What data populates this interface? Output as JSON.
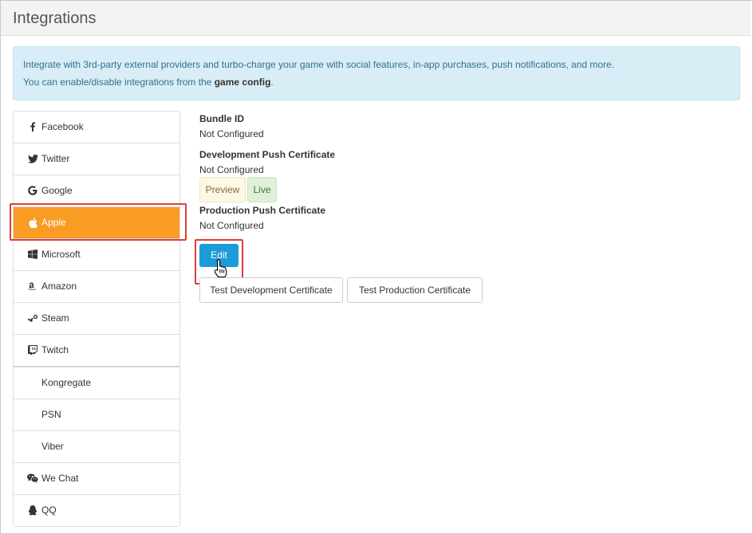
{
  "header": {
    "title": "Integrations"
  },
  "info": {
    "line1": "Integrate with 3rd-party external providers and turbo-charge your game with social features, in-app purchases, push notifications, and more.",
    "line2_prefix": "You can enable/disable integrations from the ",
    "line2_link": "game config",
    "line2_suffix": "."
  },
  "sidebar": {
    "items": [
      {
        "label": "Facebook",
        "icon": "facebook-icon"
      },
      {
        "label": "Twitter",
        "icon": "twitter-icon"
      },
      {
        "label": "Google",
        "icon": "google-icon"
      },
      {
        "label": "Apple",
        "icon": "apple-icon",
        "active": true
      },
      {
        "label": "Microsoft",
        "icon": "windows-icon"
      },
      {
        "label": "Amazon",
        "icon": "amazon-icon"
      },
      {
        "label": "Steam",
        "icon": "steam-icon"
      },
      {
        "label": "Twitch",
        "icon": "twitch-icon"
      },
      {
        "label": "Kongregate",
        "icon": ""
      },
      {
        "label": "PSN",
        "icon": ""
      },
      {
        "label": "Viber",
        "icon": ""
      },
      {
        "label": "We Chat",
        "icon": "wechat-icon"
      },
      {
        "label": "QQ",
        "icon": "qq-icon"
      }
    ]
  },
  "apple": {
    "bundle_id_label": "Bundle ID",
    "bundle_id_value": "Not Configured",
    "dev_cert_label": "Development Push Certificate",
    "dev_cert_value": "Not Configured",
    "preview_label": "Preview",
    "live_label": "Live",
    "prod_cert_label": "Production Push Certificate",
    "prod_cert_value": "Not Configured",
    "edit_label": "Edit",
    "test_dev_label": "Test Development Certificate",
    "test_prod_label": "Test Production Certificate"
  },
  "colors": {
    "active": "#f89c24",
    "primary": "#1b9bd7",
    "highlight": "#e03c3c"
  }
}
